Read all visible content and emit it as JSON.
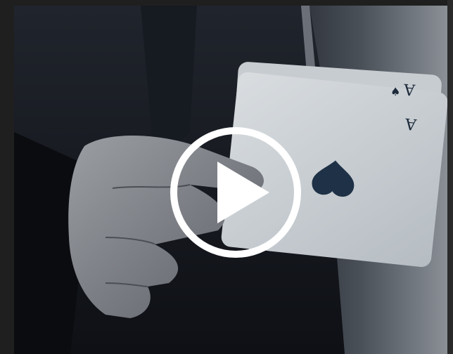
{
  "video": {
    "title": "",
    "thumbnail_subject": "hand-holding-playing-cards",
    "cards": [
      {
        "rank": "A",
        "suit": "spade"
      },
      {
        "rank": "A",
        "suit": "spade"
      }
    ]
  },
  "player": {
    "play_icon": "play-icon",
    "colors": {
      "background": "#1f1f1f",
      "play_overlay": "#ffffff"
    }
  }
}
